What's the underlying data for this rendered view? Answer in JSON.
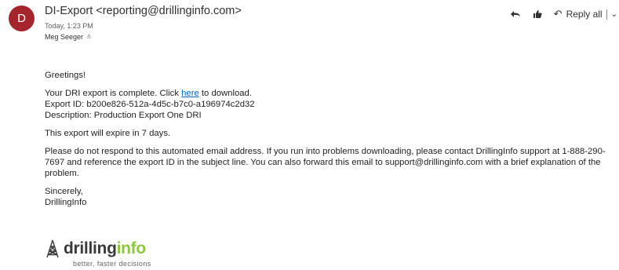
{
  "header": {
    "avatar_initial": "D",
    "avatar_color": "#a4262c",
    "sender": "DI-Export <reporting@drillinginfo.com>",
    "date": "Today, 1:23 PM",
    "recipient": "Meg Seeger"
  },
  "actions": {
    "icons": [
      "reply-fish-icon",
      "thumbs-up-icon",
      "reply-all-icon",
      "chevron-down-icon"
    ],
    "reply_all_label": "Reply all"
  },
  "message": {
    "greeting": "Greetings!",
    "line1_pre": "Your DRI export is complete. Click ",
    "link_text": "here",
    "line1_post": " to download.",
    "export_id": "Export ID: b200e826-512a-4d5c-b7c0-a196974c2d32",
    "description": "Description: Production Export One DRI",
    "expire": "This export will expire in 7 days.",
    "notice": "Please do not respond to this automated email address. If you run into problems downloading, please contact DrillingInfo support at 1-888-290-7697 and reference the export ID in the subject line. You can also forward this email to support@drillinginfo.com with a brief explanation of the problem.",
    "closing": "Sincerely,",
    "signature": "DrillingInfo"
  },
  "logo": {
    "word_drill": "drilling",
    "word_info": "info",
    "tagline": "better, faster decisions",
    "accent_color": "#8cc63f"
  }
}
